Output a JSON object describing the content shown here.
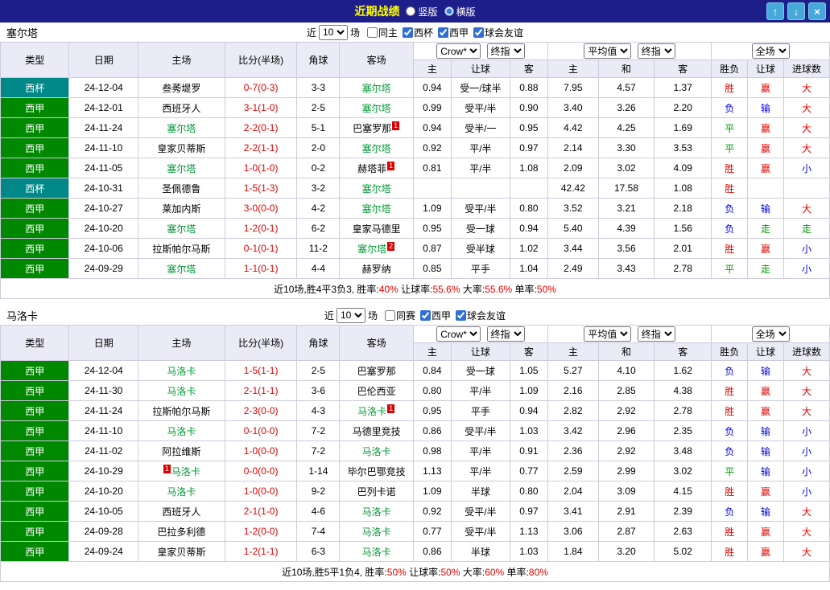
{
  "colors": {
    "titlebar_bg": "#1e1e8a",
    "title_text": "#ffff00",
    "button_bg": "#47a9da",
    "button_border": "#7cc9ea",
    "header_bg": "#ebebf7",
    "border": "#ccccdd",
    "league_bg": "#008800",
    "cup_bg": "#008888",
    "self_team": "#009933",
    "red": "#e60000",
    "blue": "#0000dd",
    "green": "#009900"
  },
  "titlebar": {
    "title": "近期战绩",
    "layout_options": [
      {
        "label": "竖版",
        "selected": false
      },
      {
        "label": "横版",
        "selected": true
      }
    ],
    "buttons": [
      {
        "name": "up",
        "glyph": "↑"
      },
      {
        "name": "down",
        "glyph": "↓"
      },
      {
        "name": "close",
        "glyph": "×"
      }
    ]
  },
  "labels": {
    "near": "近",
    "games": "场"
  },
  "selects": {
    "count": "10",
    "bookmaker": "Crow*",
    "handicap_stage": "终指",
    "average": "平均值",
    "odds_stage": "终指",
    "scope": "全场"
  },
  "table_headers": {
    "comp": "类型",
    "date": "日期",
    "home": "主场",
    "score": "比分(半场)",
    "corners": "角球",
    "away": "客场",
    "ah_home": "主",
    "ah_line": "让球",
    "ah_away": "客",
    "o_home": "主",
    "o_draw": "和",
    "o_away": "客",
    "result": "胜负",
    "ah_result": "让球",
    "goals": "进球数"
  },
  "sections": [
    {
      "team": "塞尔塔",
      "checkboxes": [
        {
          "label": "同主",
          "checked": false
        },
        {
          "label": "西杯",
          "checked": true
        },
        {
          "label": "西甲",
          "checked": true
        },
        {
          "label": "球会友谊",
          "checked": true
        }
      ],
      "rows": [
        {
          "comp": "西杯",
          "cup": true,
          "date": "24-12-04",
          "home": {
            "name": "叁莠堤罗"
          },
          "score": "0-7(0-3)",
          "corners": "3-3",
          "away": {
            "name": "塞尔塔",
            "self": true
          },
          "ah": [
            "0.94",
            "受一/球半",
            "0.88"
          ],
          "odds": [
            "7.95",
            "4.57",
            "1.37"
          ],
          "res": [
            "胜",
            "r"
          ],
          "ahr": [
            "赢",
            "r"
          ],
          "our": [
            "大",
            "r"
          ]
        },
        {
          "comp": "西甲",
          "date": "24-12-01",
          "home": {
            "name": "西班牙人"
          },
          "score": "3-1(1-0)",
          "corners": "2-5",
          "away": {
            "name": "塞尔塔",
            "self": true
          },
          "ah": [
            "0.99",
            "受平/半",
            "0.90"
          ],
          "odds": [
            "3.40",
            "3.26",
            "2.20"
          ],
          "res": [
            "负",
            "b"
          ],
          "ahr": [
            "输",
            "b"
          ],
          "our": [
            "大",
            "r"
          ]
        },
        {
          "comp": "西甲",
          "date": "24-11-24",
          "home": {
            "name": "塞尔塔",
            "self": true
          },
          "score": "2-2(0-1)",
          "corners": "5-1",
          "away": {
            "name": "巴塞罗那",
            "badge": "1"
          },
          "ah": [
            "0.94",
            "受半/一",
            "0.95"
          ],
          "odds": [
            "4.42",
            "4.25",
            "1.69"
          ],
          "res": [
            "平",
            "g"
          ],
          "ahr": [
            "赢",
            "r"
          ],
          "our": [
            "大",
            "r"
          ]
        },
        {
          "comp": "西甲",
          "date": "24-11-10",
          "home": {
            "name": "皇家贝蒂斯"
          },
          "score": "2-2(1-1)",
          "corners": "2-0",
          "away": {
            "name": "塞尔塔",
            "self": true
          },
          "ah": [
            "0.92",
            "平/半",
            "0.97"
          ],
          "odds": [
            "2.14",
            "3.30",
            "3.53"
          ],
          "res": [
            "平",
            "g"
          ],
          "ahr": [
            "赢",
            "r"
          ],
          "our": [
            "大",
            "r"
          ]
        },
        {
          "comp": "西甲",
          "date": "24-11-05",
          "home": {
            "name": "塞尔塔",
            "self": true
          },
          "score": "1-0(1-0)",
          "corners": "0-2",
          "away": {
            "name": "赫塔菲",
            "badge": "1"
          },
          "ah": [
            "0.81",
            "平/半",
            "1.08"
          ],
          "odds": [
            "2.09",
            "3.02",
            "4.09"
          ],
          "res": [
            "胜",
            "r"
          ],
          "ahr": [
            "赢",
            "r"
          ],
          "our": [
            "小",
            "b"
          ]
        },
        {
          "comp": "西杯",
          "cup": true,
          "date": "24-10-31",
          "home": {
            "name": "圣佩德鲁"
          },
          "score": "1-5(1-3)",
          "corners": "3-2",
          "away": {
            "name": "塞尔塔",
            "self": true
          },
          "ah": [
            "",
            "",
            ""
          ],
          "odds": [
            "42.42",
            "17.58",
            "1.08"
          ],
          "res": [
            "胜",
            "r"
          ],
          "ahr": [
            "",
            ""
          ],
          "our": [
            "",
            ""
          ]
        },
        {
          "comp": "西甲",
          "date": "24-10-27",
          "home": {
            "name": "莱加内斯"
          },
          "score": "3-0(0-0)",
          "corners": "4-2",
          "away": {
            "name": "塞尔塔",
            "self": true
          },
          "ah": [
            "1.09",
            "受平/半",
            "0.80"
          ],
          "odds": [
            "3.52",
            "3.21",
            "2.18"
          ],
          "res": [
            "负",
            "b"
          ],
          "ahr": [
            "输",
            "b"
          ],
          "our": [
            "大",
            "r"
          ]
        },
        {
          "comp": "西甲",
          "date": "24-10-20",
          "home": {
            "name": "塞尔塔",
            "self": true
          },
          "score": "1-2(0-1)",
          "corners": "6-2",
          "away": {
            "name": "皇家马德里"
          },
          "ah": [
            "0.95",
            "受一球",
            "0.94"
          ],
          "odds": [
            "5.40",
            "4.39",
            "1.56"
          ],
          "res": [
            "负",
            "b"
          ],
          "ahr": [
            "走",
            "g"
          ],
          "our": [
            "走",
            "g"
          ]
        },
        {
          "comp": "西甲",
          "date": "24-10-06",
          "home": {
            "name": "拉斯帕尔马斯"
          },
          "score": "0-1(0-1)",
          "corners": "11-2",
          "away": {
            "name": "塞尔塔",
            "self": true,
            "badge": "2"
          },
          "ah": [
            "0.87",
            "受半球",
            "1.02"
          ],
          "odds": [
            "3.44",
            "3.56",
            "2.01"
          ],
          "res": [
            "胜",
            "r"
          ],
          "ahr": [
            "赢",
            "r"
          ],
          "our": [
            "小",
            "b"
          ]
        },
        {
          "comp": "西甲",
          "date": "24-09-29",
          "home": {
            "name": "塞尔塔",
            "self": true
          },
          "score": "1-1(0-1)",
          "corners": "4-4",
          "away": {
            "name": "赫罗纳"
          },
          "ah": [
            "0.85",
            "平手",
            "1.04"
          ],
          "odds": [
            "2.49",
            "3.43",
            "2.78"
          ],
          "res": [
            "平",
            "g"
          ],
          "ahr": [
            "走",
            "g"
          ],
          "our": [
            "小",
            "b"
          ]
        }
      ],
      "summary": [
        {
          "t": "近10场,胜4平3负3, 胜率:"
        },
        {
          "t": "40%",
          "red": true
        },
        {
          "t": " 让球率:"
        },
        {
          "t": "55.6%",
          "red": true
        },
        {
          "t": " 大率:"
        },
        {
          "t": "55.6%",
          "red": true
        },
        {
          "t": " 单率:"
        },
        {
          "t": "50%",
          "red": true
        }
      ]
    },
    {
      "team": "马洛卡",
      "checkboxes": [
        {
          "label": "同赛",
          "checked": false
        },
        {
          "label": "西甲",
          "checked": true
        },
        {
          "label": "球会友谊",
          "checked": true
        }
      ],
      "rows": [
        {
          "comp": "西甲",
          "date": "24-12-04",
          "home": {
            "name": "马洛卡",
            "self": true
          },
          "score": "1-5(1-1)",
          "corners": "2-5",
          "away": {
            "name": "巴塞罗那"
          },
          "ah": [
            "0.84",
            "受一球",
            "1.05"
          ],
          "odds": [
            "5.27",
            "4.10",
            "1.62"
          ],
          "res": [
            "负",
            "b"
          ],
          "ahr": [
            "输",
            "b"
          ],
          "our": [
            "大",
            "r"
          ]
        },
        {
          "comp": "西甲",
          "date": "24-11-30",
          "home": {
            "name": "马洛卡",
            "self": true
          },
          "score": "2-1(1-1)",
          "corners": "3-6",
          "away": {
            "name": "巴伦西亚"
          },
          "ah": [
            "0.80",
            "平/半",
            "1.09"
          ],
          "odds": [
            "2.16",
            "2.85",
            "4.38"
          ],
          "res": [
            "胜",
            "r"
          ],
          "ahr": [
            "赢",
            "r"
          ],
          "our": [
            "大",
            "r"
          ]
        },
        {
          "comp": "西甲",
          "date": "24-11-24",
          "home": {
            "name": "拉斯帕尔马斯"
          },
          "score": "2-3(0-0)",
          "corners": "4-3",
          "away": {
            "name": "马洛卡",
            "self": true,
            "badge": "1"
          },
          "ah": [
            "0.95",
            "平手",
            "0.94"
          ],
          "odds": [
            "2.82",
            "2.92",
            "2.78"
          ],
          "res": [
            "胜",
            "r"
          ],
          "ahr": [
            "赢",
            "r"
          ],
          "our": [
            "大",
            "r"
          ]
        },
        {
          "comp": "西甲",
          "date": "24-11-10",
          "home": {
            "name": "马洛卡",
            "self": true
          },
          "score": "0-1(0-0)",
          "corners": "7-2",
          "away": {
            "name": "马德里竞技"
          },
          "ah": [
            "0.86",
            "受平/半",
            "1.03"
          ],
          "odds": [
            "3.42",
            "2.96",
            "2.35"
          ],
          "res": [
            "负",
            "b"
          ],
          "ahr": [
            "输",
            "b"
          ],
          "our": [
            "小",
            "b"
          ]
        },
        {
          "comp": "西甲",
          "date": "24-11-02",
          "home": {
            "name": "阿拉维斯"
          },
          "score": "1-0(0-0)",
          "corners": "7-2",
          "away": {
            "name": "马洛卡",
            "self": true
          },
          "ah": [
            "0.98",
            "平/半",
            "0.91"
          ],
          "odds": [
            "2.36",
            "2.92",
            "3.48"
          ],
          "res": [
            "负",
            "b"
          ],
          "ahr": [
            "输",
            "b"
          ],
          "our": [
            "小",
            "b"
          ]
        },
        {
          "comp": "西甲",
          "date": "24-10-29",
          "home": {
            "name": "马洛卡",
            "self": true,
            "badge": "1",
            "badge_pos": "before"
          },
          "score": "0-0(0-0)",
          "corners": "1-14",
          "away": {
            "name": "毕尔巴鄂竞技"
          },
          "ah": [
            "1.13",
            "平/半",
            "0.77"
          ],
          "odds": [
            "2.59",
            "2.99",
            "3.02"
          ],
          "res": [
            "平",
            "g"
          ],
          "ahr": [
            "输",
            "b"
          ],
          "our": [
            "小",
            "b"
          ]
        },
        {
          "comp": "西甲",
          "date": "24-10-20",
          "home": {
            "name": "马洛卡",
            "self": true
          },
          "score": "1-0(0-0)",
          "corners": "9-2",
          "away": {
            "name": "巴列卡诺"
          },
          "ah": [
            "1.09",
            "半球",
            "0.80"
          ],
          "odds": [
            "2.04",
            "3.09",
            "4.15"
          ],
          "res": [
            "胜",
            "r"
          ],
          "ahr": [
            "赢",
            "r"
          ],
          "our": [
            "小",
            "b"
          ]
        },
        {
          "comp": "西甲",
          "date": "24-10-05",
          "home": {
            "name": "西班牙人"
          },
          "score": "2-1(1-0)",
          "corners": "4-6",
          "away": {
            "name": "马洛卡",
            "self": true
          },
          "ah": [
            "0.92",
            "受平/半",
            "0.97"
          ],
          "odds": [
            "3.41",
            "2.91",
            "2.39"
          ],
          "res": [
            "负",
            "b"
          ],
          "ahr": [
            "输",
            "b"
          ],
          "our": [
            "大",
            "r"
          ]
        },
        {
          "comp": "西甲",
          "date": "24-09-28",
          "home": {
            "name": "巴拉多利德"
          },
          "score": "1-2(0-0)",
          "corners": "7-4",
          "away": {
            "name": "马洛卡",
            "self": true
          },
          "ah": [
            "0.77",
            "受平/半",
            "1.13"
          ],
          "odds": [
            "3.06",
            "2.87",
            "2.63"
          ],
          "res": [
            "胜",
            "r"
          ],
          "ahr": [
            "赢",
            "r"
          ],
          "our": [
            "大",
            "r"
          ]
        },
        {
          "comp": "西甲",
          "date": "24-09-24",
          "home": {
            "name": "皇家贝蒂斯"
          },
          "score": "1-2(1-1)",
          "corners": "6-3",
          "away": {
            "name": "马洛卡",
            "self": true
          },
          "ah": [
            "0.86",
            "半球",
            "1.03"
          ],
          "odds": [
            "1.84",
            "3.20",
            "5.02"
          ],
          "res": [
            "胜",
            "r"
          ],
          "ahr": [
            "赢",
            "r"
          ],
          "our": [
            "大",
            "r"
          ]
        }
      ],
      "summary": [
        {
          "t": "近10场,胜5平1负4, 胜率:"
        },
        {
          "t": "50%",
          "red": true
        },
        {
          "t": " 让球率:"
        },
        {
          "t": "50%",
          "red": true
        },
        {
          "t": " 大率:"
        },
        {
          "t": "60%",
          "red": true
        },
        {
          "t": " 单率:"
        },
        {
          "t": "80%",
          "red": true
        }
      ]
    }
  ]
}
